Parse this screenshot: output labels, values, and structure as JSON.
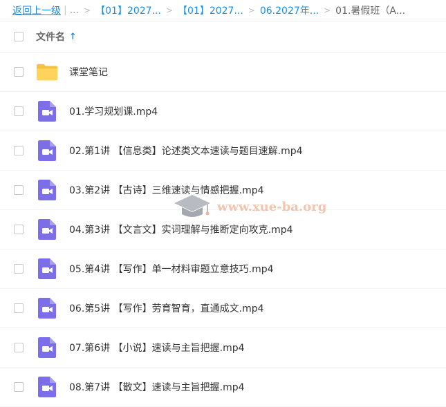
{
  "breadcrumb": {
    "back": "返回上一级",
    "pipe": "|",
    "dots": "...",
    "crumbs": [
      "【01】2027...",
      "【01】2027...",
      "06.2027年..."
    ],
    "current": "01.暑假班（A...",
    "sep": ">"
  },
  "list_header": {
    "column_title": "文件名",
    "sort_arrow": "↑"
  },
  "rows": [
    {
      "name": "课堂笔记",
      "icon": "folder-icon"
    },
    {
      "name": "01.学习规划课.mp4",
      "icon": "video-icon"
    },
    {
      "name": "02.第1讲 【信息类】论述类文本速读与题目速解.mp4",
      "icon": "video-icon"
    },
    {
      "name": "03.第2讲 【古诗】三维速读与情感把握.mp4",
      "icon": "video-icon"
    },
    {
      "name": "04.第3讲 【文言文】实词理解与推断定向攻克.mp4",
      "icon": "video-icon"
    },
    {
      "name": "05.第4讲 【写作】单一材料审题立意技巧.mp4",
      "icon": "video-icon"
    },
    {
      "name": "06.第5讲 【写作】劳育智育，直通成文.mp4",
      "icon": "video-icon"
    },
    {
      "name": "07.第6讲 【小说】速读与主旨把握.mp4",
      "icon": "video-icon"
    },
    {
      "name": "08.第7讲 【散文】速读与主旨把握.mp4",
      "icon": "video-icon"
    }
  ],
  "watermark": {
    "text": "www.xue-ba.org"
  },
  "colors": {
    "accent": "#1a8fe6",
    "folder": "#f5c242",
    "video": "#7b6ee8"
  }
}
